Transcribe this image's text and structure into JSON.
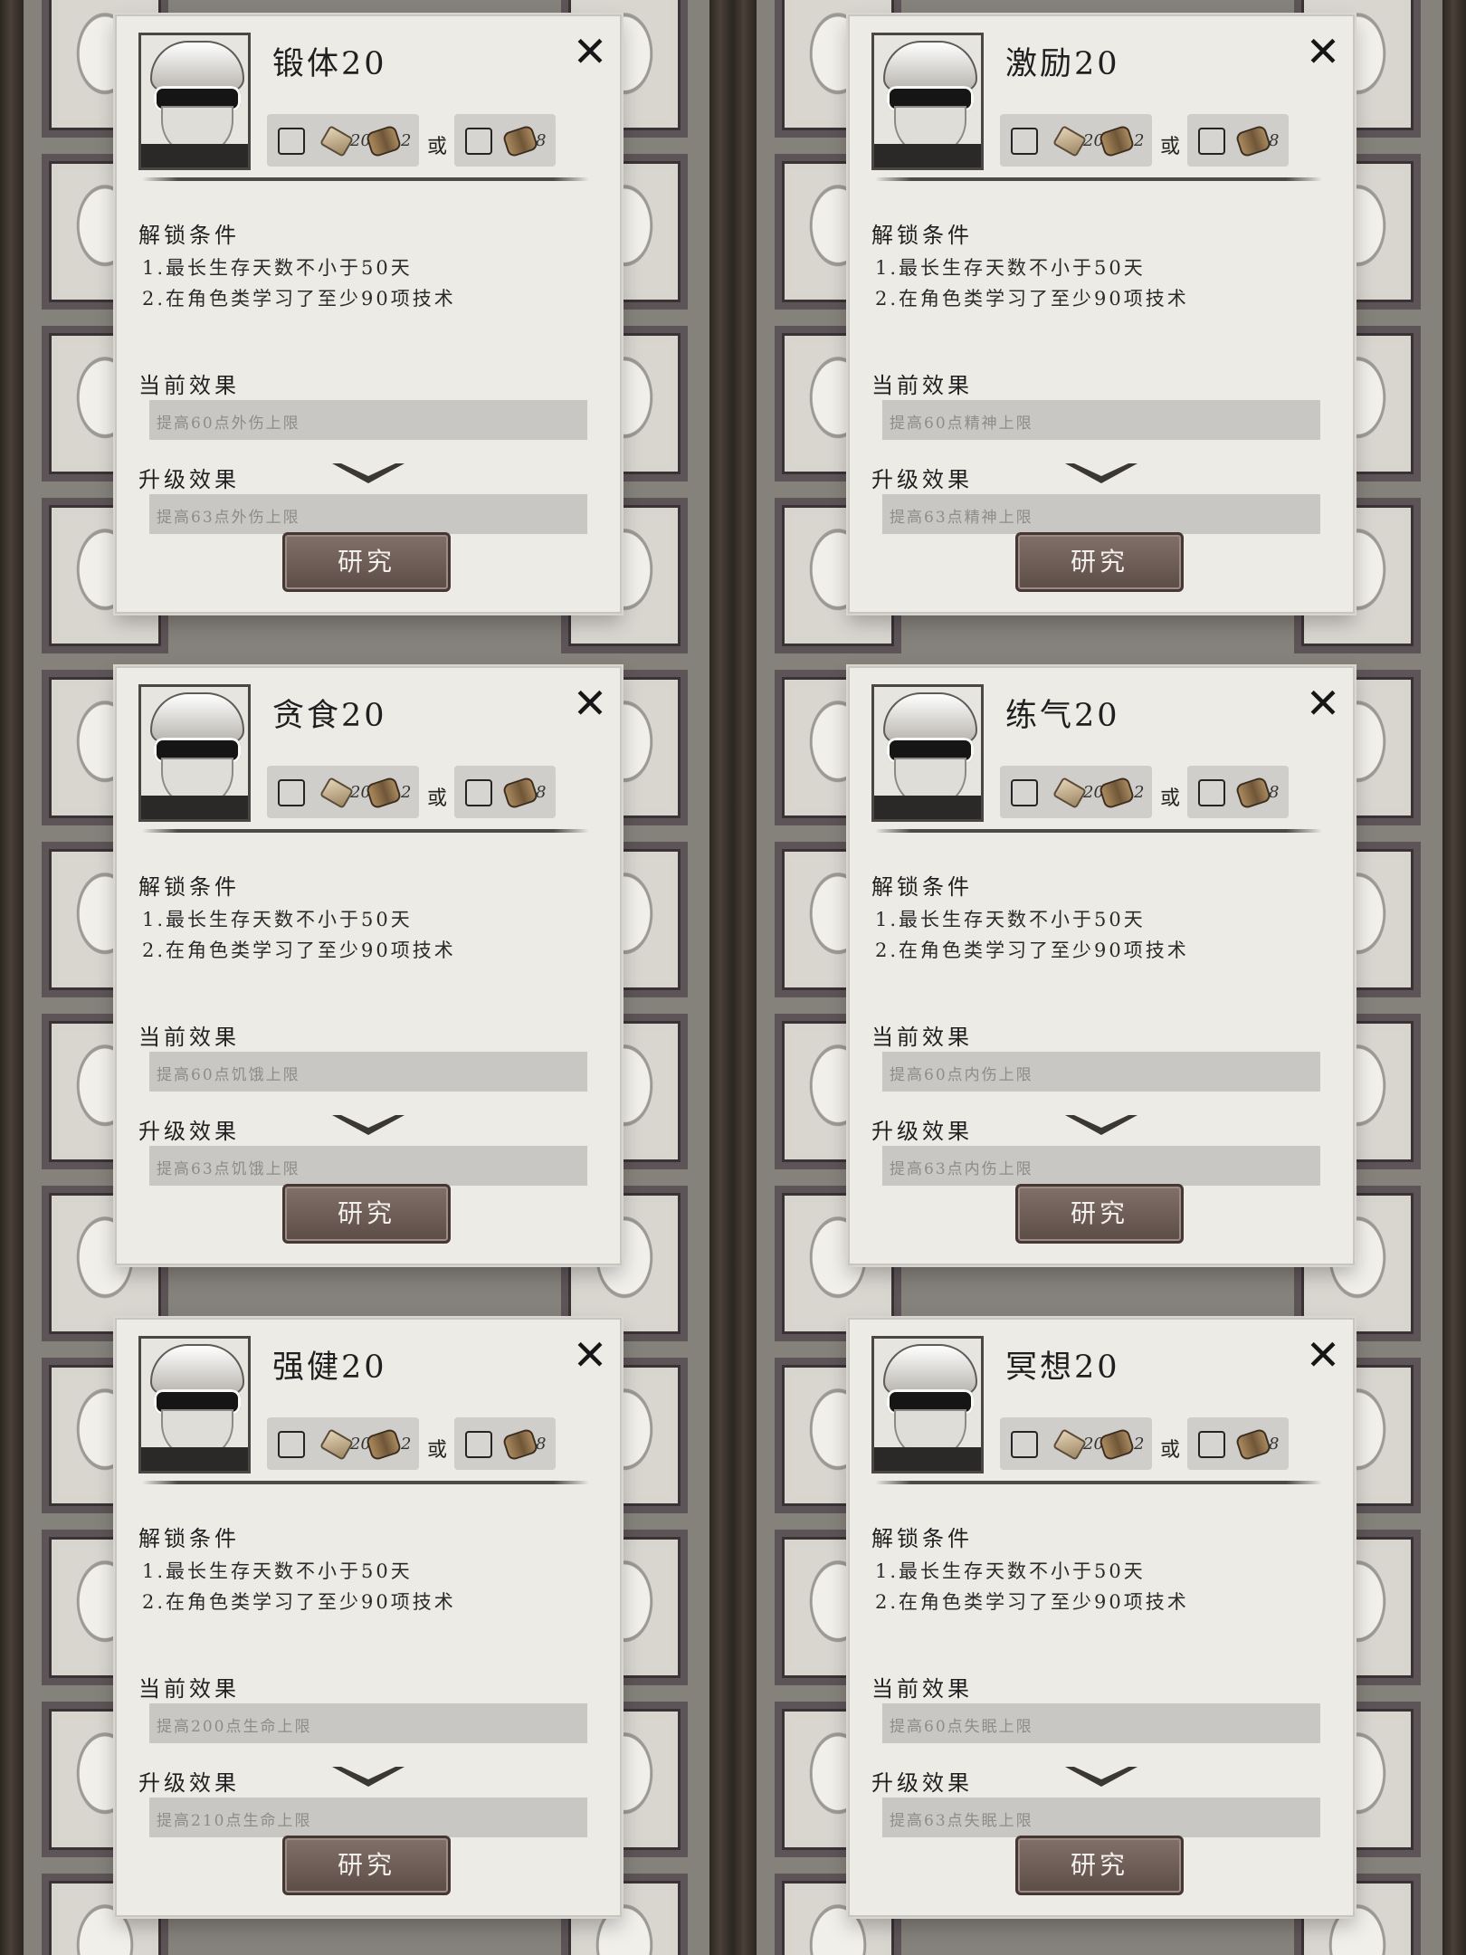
{
  "ui": {
    "or_label": "或",
    "unlock_heading": "解锁条件",
    "current_heading": "当前效果",
    "upgrade_heading": "升级效果",
    "research_label": "研究",
    "close_glyph": "✕",
    "cost": {
      "stone_count": "20",
      "scroll_count": "2",
      "alt_scroll_count": "8"
    },
    "conditions": [
      "1.最长生存天数不小于50天",
      "2.在角色类学习了至少90项技术"
    ]
  },
  "cards": [
    {
      "title": "锻体20",
      "current": "提高60点外伤上限",
      "upgrade": "提高63点外伤上限"
    },
    {
      "title": "激励20",
      "current": "提高60点精神上限",
      "upgrade": "提高63点精神上限"
    },
    {
      "title": "贪食20",
      "current": "提高60点饥饿上限",
      "upgrade": "提高63点饥饿上限"
    },
    {
      "title": "练气20",
      "current": "提高60点内伤上限",
      "upgrade": "提高63点内伤上限"
    },
    {
      "title": "强健20",
      "current": "提高200点生命上限",
      "upgrade": "提高210点生命上限"
    },
    {
      "title": "冥想20",
      "current": "提高60点失眠上限",
      "upgrade": "提高63点失眠上限"
    }
  ],
  "colors": {
    "card_bg": "#ecebe6",
    "button_bg": "#6d5d56",
    "effect_bar": "#c8c7c4"
  },
  "icons": [
    "close-icon",
    "character-portrait",
    "checkbox",
    "stone-icon",
    "scroll-icon",
    "chevron-down-icon"
  ]
}
